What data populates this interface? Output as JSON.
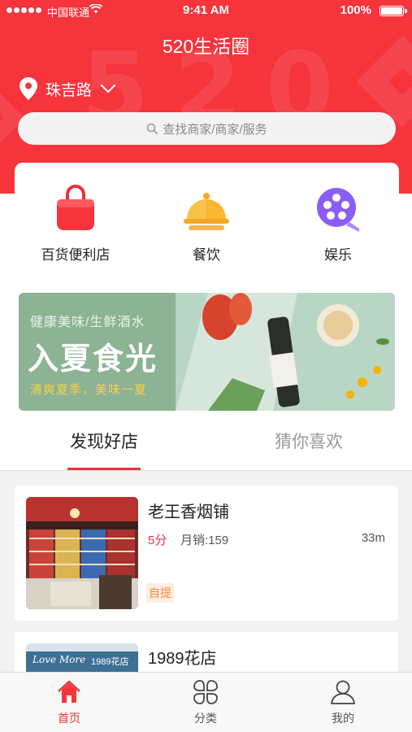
{
  "status_bar": {
    "carrier": "中国联通",
    "time": "9:41 AM",
    "battery": "100%"
  },
  "header": {
    "title": "520生活圈",
    "watermark": "520",
    "location": "珠吉路",
    "search_placeholder": "查找商家/商家/服务"
  },
  "categories": [
    {
      "label": "百货便利店",
      "icon": "shopping-bag-icon",
      "color": "#f5343c"
    },
    {
      "label": "餐饮",
      "icon": "food-cloche-icon",
      "color": "#f5a623"
    },
    {
      "label": "娱乐",
      "icon": "film-reel-icon",
      "color": "#8b5cf6"
    }
  ],
  "banner": {
    "subtitle": "健康美味/生鲜酒水",
    "headline": "入夏食光",
    "tagline": "清爽夏季，美味一夏"
  },
  "tabs": [
    {
      "label": "发现好店",
      "active": true
    },
    {
      "label": "猜你喜欢",
      "active": false
    }
  ],
  "stores": [
    {
      "name": "老王香烟铺",
      "rating": "5分",
      "sales": "月销:159",
      "distance": "33m",
      "badge": "自提"
    },
    {
      "name": "1989花店",
      "sign_text": "Love More",
      "sign_text_cn": "1989花店"
    }
  ],
  "bottom_nav": [
    {
      "label": "首页",
      "icon": "home-icon",
      "active": true
    },
    {
      "label": "分类",
      "icon": "category-grid-icon",
      "active": false
    },
    {
      "label": "我的",
      "icon": "user-icon",
      "active": false
    }
  ],
  "colors": {
    "brand_red": "#f5343c",
    "active_red": "#e8323c",
    "badge_orange": "#f58a3c"
  }
}
